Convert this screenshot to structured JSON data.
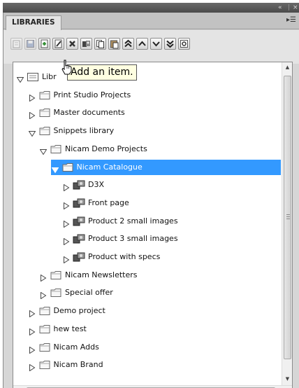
{
  "window": {
    "collapse_label": "«",
    "close_label": "×"
  },
  "panel": {
    "tab_label": "LIBRARIES",
    "menu_icon": "panel-menu-icon"
  },
  "toolbar": {
    "buttons": [
      {
        "name": "properties-button",
        "icon": "properties-icon",
        "enabled": false
      },
      {
        "name": "save-button",
        "icon": "save-icon",
        "enabled": false
      },
      {
        "name": "add-item-button",
        "icon": "add-icon",
        "enabled": true
      },
      {
        "name": "edit-item-button",
        "icon": "edit-icon",
        "enabled": true
      },
      {
        "name": "delete-button",
        "icon": "delete-icon",
        "enabled": true
      },
      {
        "name": "insert-button",
        "icon": "insert-icon",
        "enabled": true
      },
      {
        "name": "copy-button",
        "icon": "copy-icon",
        "enabled": true
      },
      {
        "name": "paste-button",
        "icon": "paste-icon",
        "enabled": true
      },
      {
        "name": "move-to-top-button",
        "icon": "double-up-icon",
        "enabled": true
      },
      {
        "name": "move-up-button",
        "icon": "up-icon",
        "enabled": true
      },
      {
        "name": "move-down-button",
        "icon": "down-icon",
        "enabled": true
      },
      {
        "name": "move-to-bottom-button",
        "icon": "double-down-icon",
        "enabled": true
      },
      {
        "name": "settings-button",
        "icon": "settings-icon",
        "enabled": true
      }
    ]
  },
  "tooltip": {
    "text": "Add an item."
  },
  "tree": {
    "root_label": "Libr",
    "items": [
      {
        "label": "Print Studio Projects",
        "level": 1,
        "expanded": false,
        "kind": "folder"
      },
      {
        "label": "Master documents",
        "level": 1,
        "expanded": false,
        "kind": "folder"
      },
      {
        "label": "Snippets library",
        "level": 1,
        "expanded": true,
        "kind": "folder"
      },
      {
        "label": "Nicam Demo Projects",
        "level": 2,
        "expanded": true,
        "kind": "folder"
      },
      {
        "label": "Nicam Catalogue",
        "level": 3,
        "expanded": true,
        "kind": "folder",
        "selected": true
      },
      {
        "label": "D3X",
        "level": 4,
        "expanded": false,
        "kind": "item"
      },
      {
        "label": "Front page",
        "level": 4,
        "expanded": false,
        "kind": "item"
      },
      {
        "label": "Product 2 small images",
        "level": 4,
        "expanded": false,
        "kind": "item"
      },
      {
        "label": "Product 3 small images",
        "level": 4,
        "expanded": false,
        "kind": "item"
      },
      {
        "label": "Product with specs",
        "level": 4,
        "expanded": false,
        "kind": "item"
      },
      {
        "label": "Nicam Newsletters",
        "level": 2,
        "expanded": false,
        "kind": "folder"
      },
      {
        "label": "Special offer",
        "level": 2,
        "expanded": false,
        "kind": "folder"
      },
      {
        "label": "Demo project",
        "level": 1,
        "expanded": false,
        "kind": "folder"
      },
      {
        "label": "hew test",
        "level": 1,
        "expanded": false,
        "kind": "folder"
      },
      {
        "label": "Nicam Adds",
        "level": 1,
        "expanded": false,
        "kind": "folder"
      },
      {
        "label": "Nicam Brand",
        "level": 1,
        "expanded": false,
        "kind": "folder"
      }
    ]
  },
  "colors": {
    "selection": "#3399ff",
    "panel": "#d6d6d6",
    "tooltip": "#ffffe1"
  }
}
